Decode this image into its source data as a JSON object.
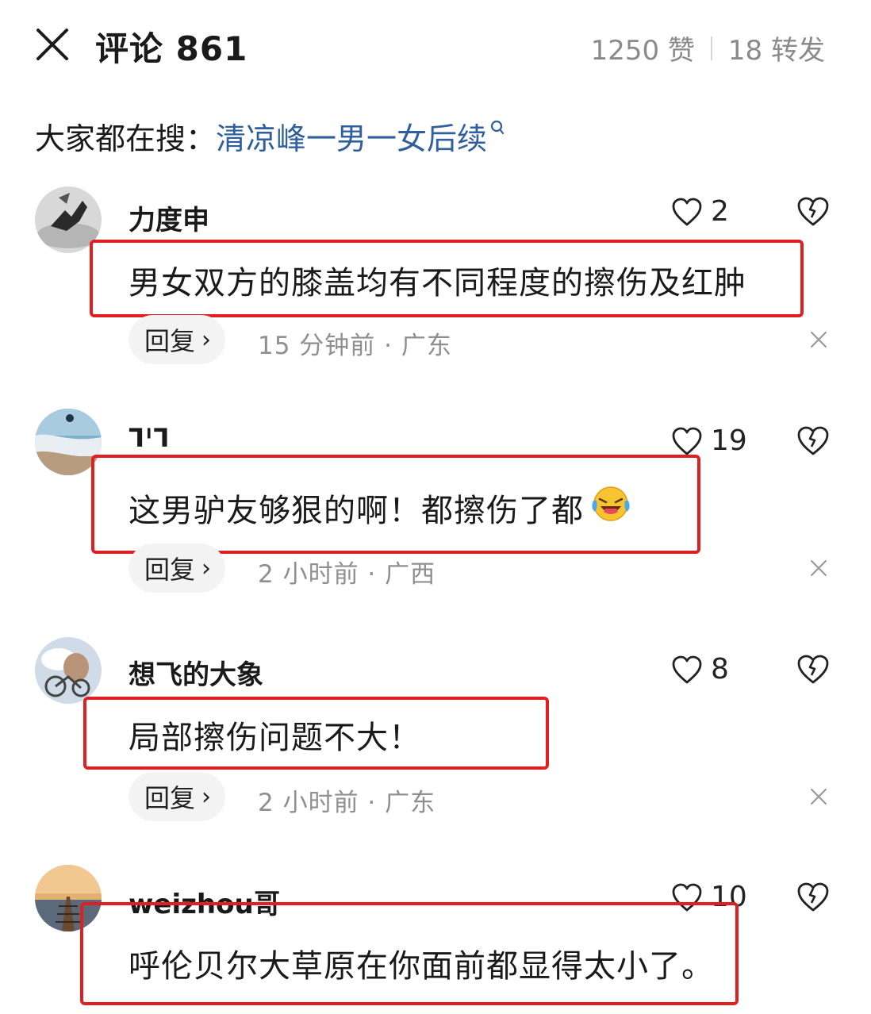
{
  "header": {
    "title": "评论 861",
    "likes": "1250 赞",
    "shares": "18 转发"
  },
  "search": {
    "label": "大家都在搜：",
    "query": "清凉峰一男一女后续"
  },
  "colors": {
    "highlight_border": "#e02020",
    "link": "#2f5f9e",
    "meta_text": "#8f8f8f"
  },
  "comments": [
    {
      "username": "力度申",
      "text": "男女双方的膝盖均有不同程度的擦伤及红肿",
      "likes": "2",
      "reply_label": "回复",
      "meta": "15 分钟前 · 广东"
    },
    {
      "username": "ᒣᑊᒣ",
      "text": "这男驴友够狠的啊！都擦伤了都",
      "emoji": "laughing-crying-emoji",
      "likes": "19",
      "reply_label": "回复",
      "meta": "2 小时前 · 广西"
    },
    {
      "username": "想飞的大象",
      "text": "局部擦伤问题不大！",
      "likes": "8",
      "reply_label": "回复",
      "meta": "2 小时前 · 广东"
    },
    {
      "username": "weizhou哥",
      "text": "呼伦贝尔大草原在你面前都显得太小了。",
      "likes": "10",
      "reply_label": "回复",
      "meta": ""
    }
  ]
}
